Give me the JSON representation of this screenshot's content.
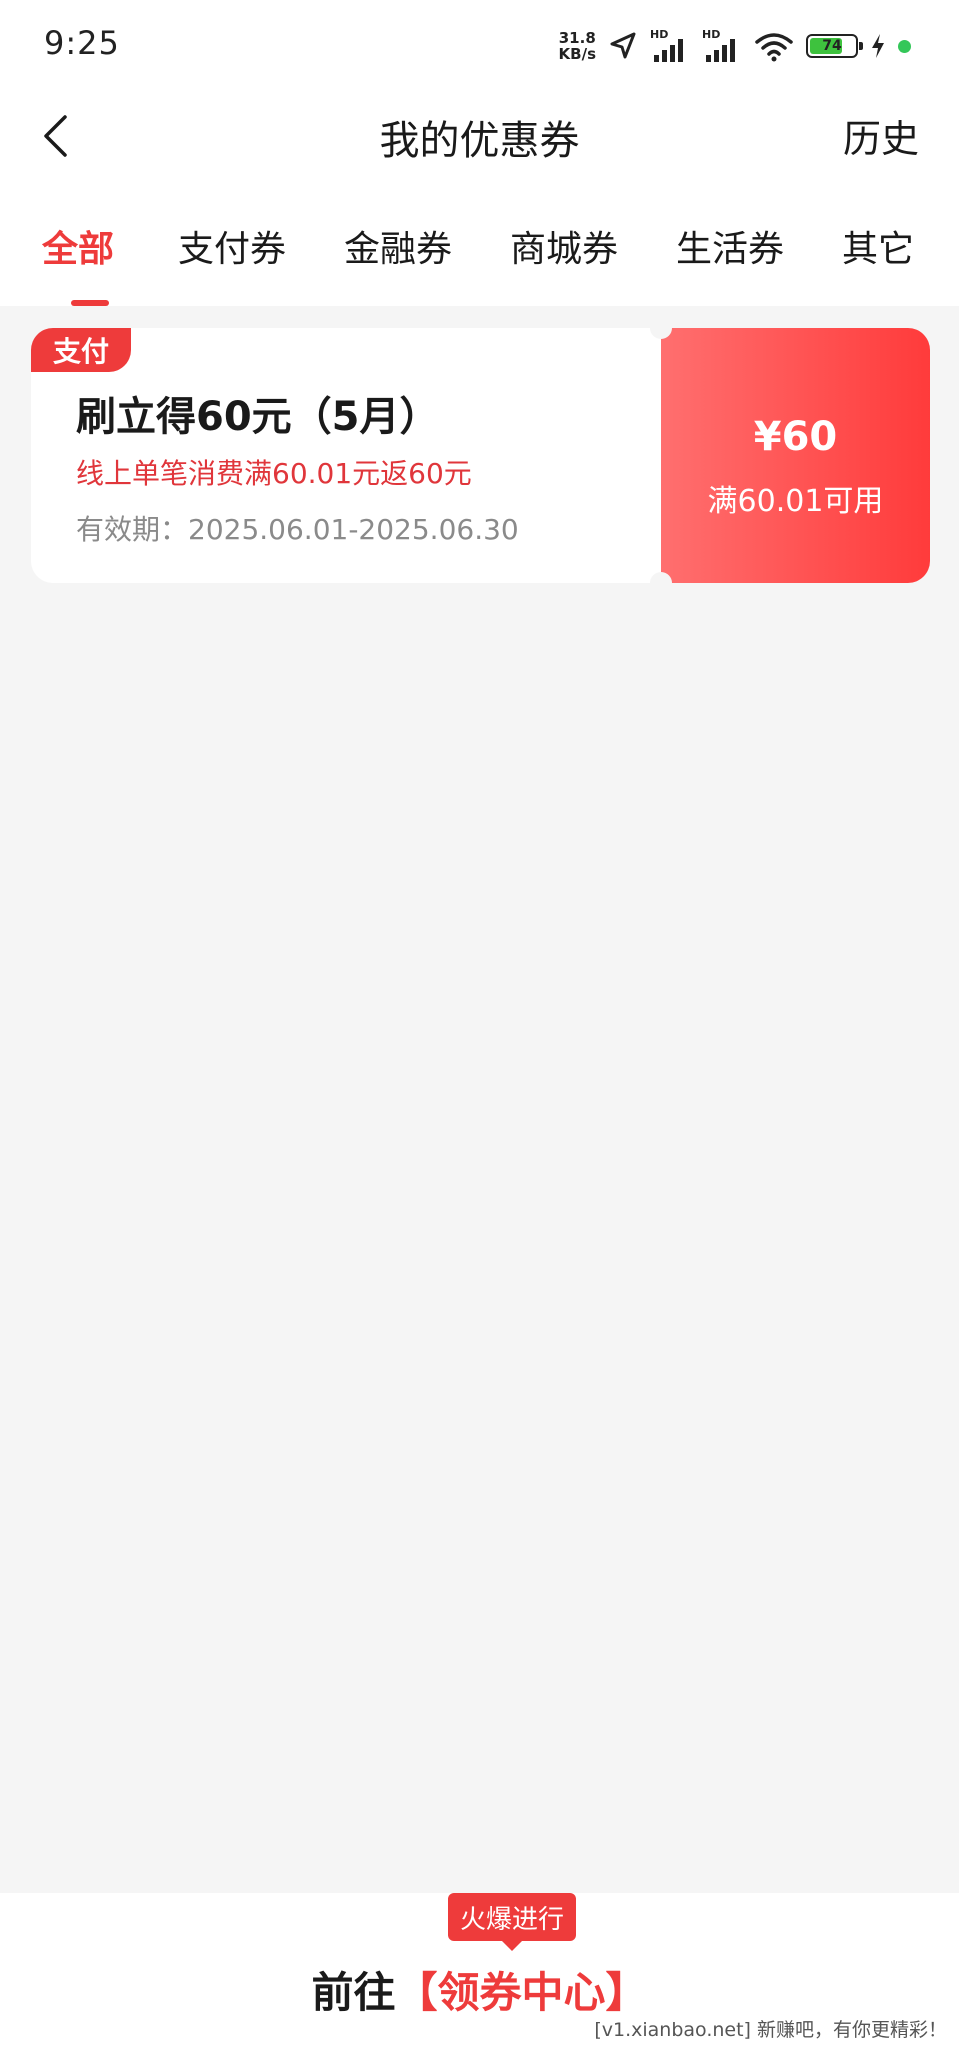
{
  "status_bar": {
    "time": "9:25",
    "net_speed_value": "31.8",
    "net_speed_unit": "KB/s",
    "signal_label_1": "HD",
    "signal_label_2": "HD",
    "battery_level": "74",
    "battery_fraction": 0.74,
    "icons": [
      "location-arrow-icon",
      "signal-icon",
      "signal-icon",
      "wifi-icon",
      "battery-icon",
      "charging-bolt-icon",
      "green-dot-icon"
    ],
    "colors": {
      "battery_fill": "#3ec23e",
      "dot": "#34c759"
    }
  },
  "nav": {
    "title": "我的优惠券",
    "history_label": "历史",
    "back_icon": "chevron-left-icon"
  },
  "tabs": [
    {
      "label": "全部",
      "active": true
    },
    {
      "label": "支付券",
      "active": false
    },
    {
      "label": "金融券",
      "active": false
    },
    {
      "label": "商城券",
      "active": false
    },
    {
      "label": "生活券",
      "active": false
    },
    {
      "label": "其它",
      "active": false
    }
  ],
  "coupons": [
    {
      "badge": "支付",
      "title": "刷立得60元（5月）",
      "description": "线上单笔消费满60.01元返60元",
      "validity": "有效期：2025.06.01-2025.06.30",
      "amount": "¥60",
      "condition": "满60.01可用"
    }
  ],
  "bottom": {
    "hot_badge": "火爆进行",
    "goto_prefix": "前往",
    "goto_link": "【领券中心】"
  },
  "watermark": "[v1.xianbao.net] 新赚吧，有你更精彩！",
  "colors": {
    "accent": "#ee3b3b",
    "coupon_gradient_start": "#ff6f6f",
    "coupon_gradient_end": "#ff3b3b",
    "background": "#f5f5f5"
  }
}
